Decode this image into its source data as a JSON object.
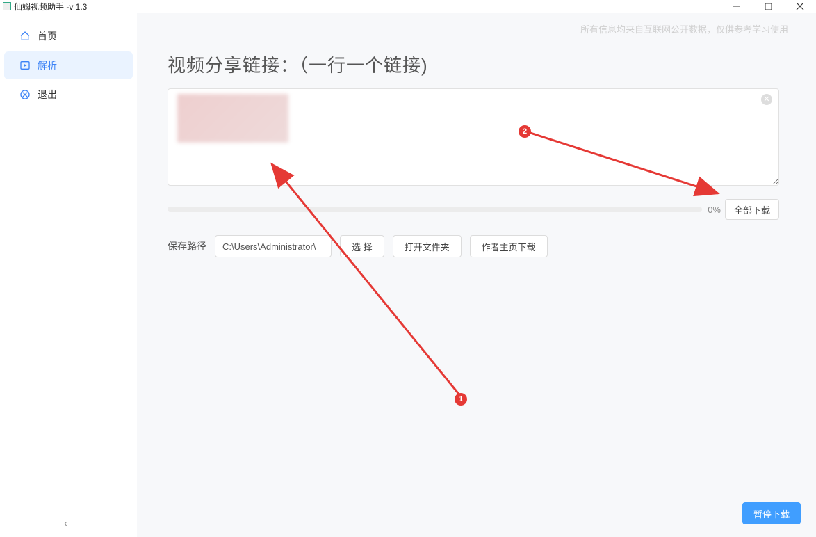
{
  "window": {
    "title": "仙姆视频助手 -v 1.3"
  },
  "sidebar": {
    "items": [
      {
        "label": "首页",
        "icon": "home-icon"
      },
      {
        "label": "解析",
        "icon": "parse-icon"
      },
      {
        "label": "退出",
        "icon": "exit-icon"
      }
    ]
  },
  "main": {
    "disclaimer": "所有信息均来自互联网公开数据，仅供参考学习使用",
    "heading": "视频分享链接：（一行一个链接)",
    "textarea_value": "",
    "progress_percent": "0%",
    "download_all_label": "全部下载",
    "path_label": "保存路径",
    "path_value": "C:\\Users\\Administrator\\",
    "choose_label": "选 择",
    "open_folder_label": "打开文件夹",
    "author_dl_label": "作者主页下载",
    "pause_label": "暂停下载"
  },
  "annotations": {
    "badge1": "1",
    "badge2": "2"
  }
}
